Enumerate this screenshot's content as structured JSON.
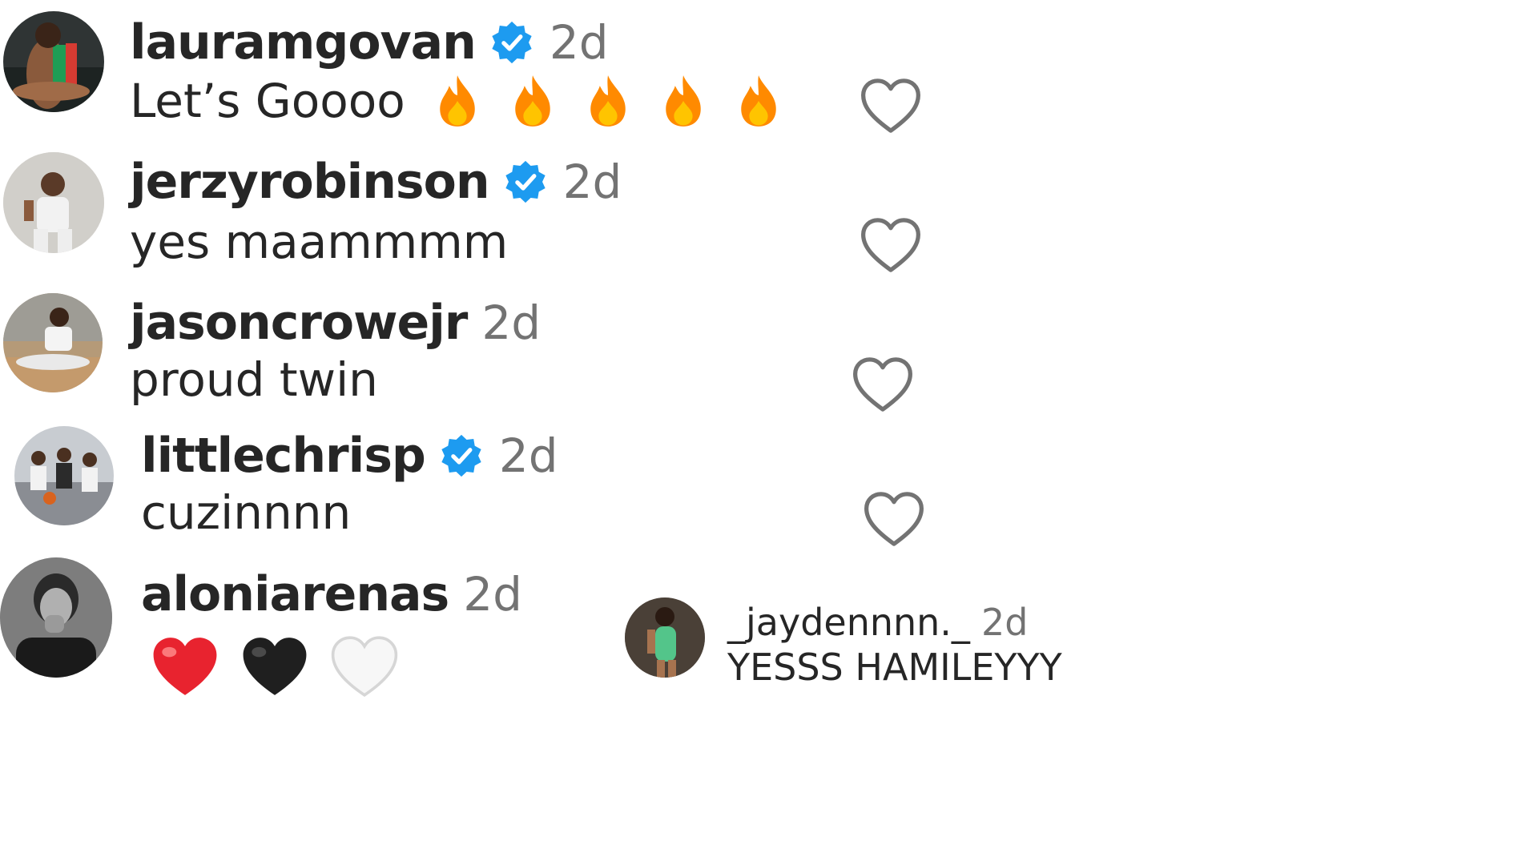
{
  "colors": {
    "verified": "#1d9bf0",
    "timestamp": "#737373",
    "text": "#262626",
    "flame": "#ff8a00",
    "red_heart": "#e8232f"
  },
  "comments": [
    {
      "username": "lauramgovan",
      "verified": true,
      "time": "2d",
      "text": "Let’s Goooo",
      "emoji": [
        "fire",
        "fire",
        "fire",
        "fire",
        "fire"
      ]
    },
    {
      "username": "jerzyrobinson",
      "verified": true,
      "time": "2d",
      "text": "yes maammmm"
    },
    {
      "username": "jasoncrowejr",
      "verified": false,
      "time": "2d",
      "text": "proud twin"
    },
    {
      "username": "littlechrisp",
      "verified": true,
      "time": "2d",
      "text": "cuzinnnn"
    },
    {
      "username": "aloniarenas",
      "verified": false,
      "time": "2d",
      "emoji": [
        "red-heart",
        "black-heart",
        "white-heart"
      ]
    }
  ],
  "reply": {
    "username": "_jaydennnn._",
    "time": "2d",
    "text": "YESSS HAMILEYYY"
  },
  "icons": {
    "like": "heart-outline-icon",
    "verified": "verified-badge-icon",
    "fire": "fire-emoji-icon"
  }
}
